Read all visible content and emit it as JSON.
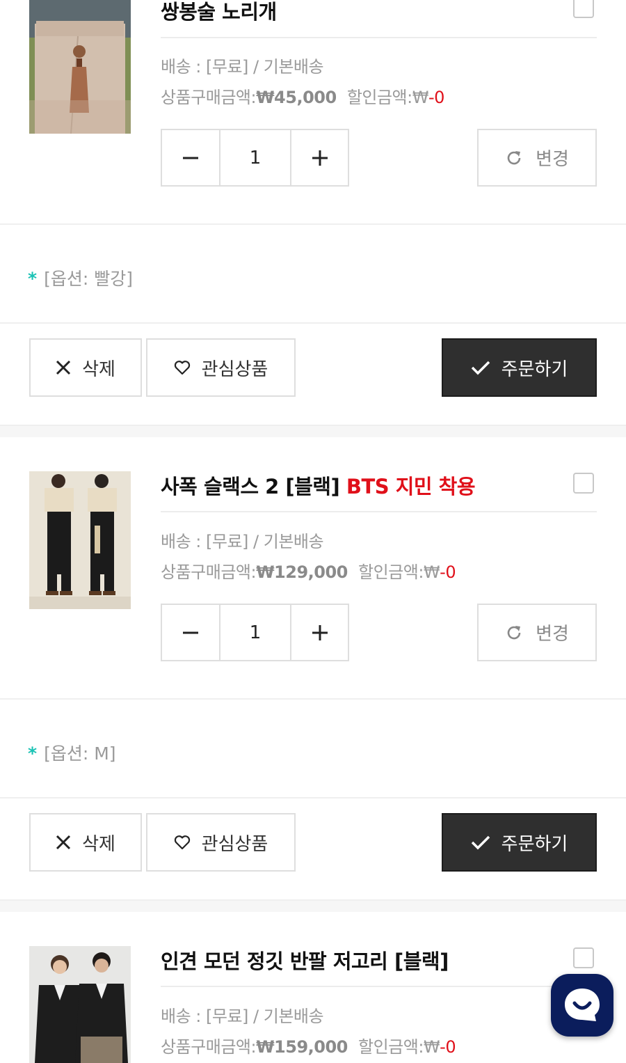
{
  "items": [
    {
      "title_main": "쌍봉술 노리개",
      "title_highlight": "",
      "shipping": "배송 : [무료] / 기본배송",
      "price_label": "상품구매금액:",
      "price": "₩45,000",
      "discount_label": "할인금액:",
      "discount_currency": "₩",
      "discount": "-0",
      "quantity": "1",
      "change_label": "변경",
      "option": "[옵션: 빨강]",
      "delete_label": "삭제",
      "wishlist_label": "관심상품",
      "order_label": "주문하기"
    },
    {
      "title_main": "사폭 슬랙스 2 [블랙]",
      "title_highlight": "BTS 지민 착용",
      "shipping": "배송 : [무료] / 기본배송",
      "price_label": "상품구매금액:",
      "price": "₩129,000",
      "discount_label": "할인금액:",
      "discount_currency": "₩",
      "discount": "-0",
      "quantity": "1",
      "change_label": "변경",
      "option": "[옵션: M]",
      "delete_label": "삭제",
      "wishlist_label": "관심상품",
      "order_label": "주문하기"
    },
    {
      "title_main": "인견 모던 정깃 반팔 저고리 [블랙]",
      "title_highlight": "",
      "shipping": "배송 : [무료] / 기본배송",
      "price_label": "상품구매금액:",
      "price": "₩159,000",
      "discount_label": "할인금액:",
      "discount_currency": "₩",
      "discount": "-0"
    }
  ],
  "option_marker": "*",
  "colors": {
    "accent_red": "#e0101a",
    "option_star": "#19c2b4",
    "order_button": "#2f2f2f",
    "chat_button": "#0b1d5c"
  },
  "icons": {
    "minus": "minus-icon",
    "plus": "plus-icon",
    "refresh": "refresh-icon",
    "close": "close-icon",
    "heart": "heart-icon",
    "check": "check-icon",
    "chat": "chat-icon"
  }
}
